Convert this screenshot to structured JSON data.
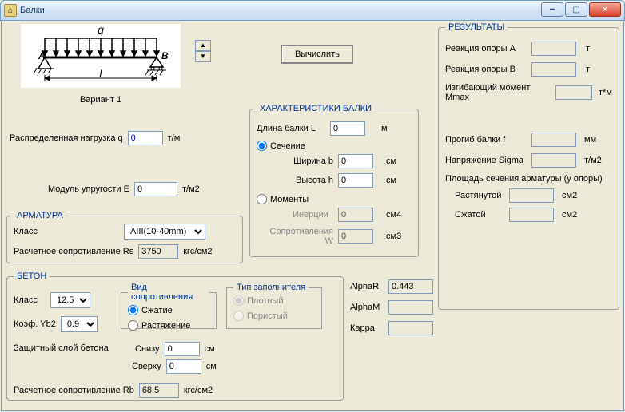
{
  "window": {
    "title": "Балки",
    "variant_label": "Вариант 1",
    "calc_button": "Вычислить"
  },
  "diagram": {
    "load_symbol": "q",
    "span_symbol": "l",
    "left_support": "A",
    "right_support": "B"
  },
  "inputs": {
    "distributed_load": {
      "label": "Распределенная нагрузка  q",
      "value": "0",
      "unit": "т/м"
    },
    "elastic_modulus": {
      "label": "Модуль упругости  E",
      "value": "0",
      "unit": "т/м2"
    }
  },
  "armatura": {
    "legend": "АРМАТУРА",
    "class_label": "Класс",
    "class_value": "AIII(10-40mm)",
    "rs_label": "Расчетное сопротивление Rs",
    "rs_value": "3750",
    "rs_unit": "кгс/см2"
  },
  "beton": {
    "legend": "БЕТОН",
    "class_label": "Класс",
    "class_value": "12.5",
    "yb2_label": "Коэф. Yb2",
    "yb2_value": "0.9",
    "resistance_group": {
      "legend": "Вид сопротивления",
      "compression": "Сжатие",
      "tension": "Растяжение"
    },
    "filler_group": {
      "legend": "Тип заполнителя",
      "dense": "Плотный",
      "porous": "Пористый"
    },
    "cover_label": "Защитный слой бетона",
    "cover_bottom_label": "Снизу",
    "cover_bottom_value": "0",
    "cover_top_label": "Сверху",
    "cover_top_value": "0",
    "cover_unit": "см",
    "rb_label": "Расчетное сопротивление Rb",
    "rb_value": "68.5",
    "rb_unit": "кгс/см2"
  },
  "characteristics": {
    "legend": "ХАРАКТЕРИСТИКИ БАЛКИ",
    "length_label": "Длина балки  L",
    "length_value": "0",
    "length_unit": "м",
    "section_radio": "Сечение",
    "width_label": "Ширина  b",
    "width_value": "0",
    "height_label": "Высота  h",
    "height_value": "0",
    "section_unit": "см",
    "moments_radio": "Моменты",
    "inertia_label": "Инерции   I",
    "inertia_value": "0",
    "inertia_unit": "см4",
    "resistance_label": "Сопротивления  W",
    "resistance_value": "0",
    "resistance_unit": "см3"
  },
  "greek": {
    "alpha_r_label": "AlphaR",
    "alpha_r_value": "0.443",
    "alpha_m_label": "AlphaM",
    "kappa_label": "Карра"
  },
  "results": {
    "legend": "РЕЗУЛЬТАТЫ",
    "reaction_a_label": "Реакция опоры A",
    "reaction_a_unit": "т",
    "reaction_b_label": "Реакция опоры B",
    "reaction_b_unit": "т",
    "mmax_label": "Изгибающий момент Mmax",
    "mmax_unit": "т*м",
    "deflection_label": "Прогиб балки   f",
    "deflection_unit": "мм",
    "sigma_label": "Напряжение Sigma",
    "sigma_unit": "т/м2",
    "rebar_area_label": "Площадь сечения арматуры (у опоры)",
    "tension_area_label": "Растянутой",
    "tension_area_unit": "см2",
    "compression_area_label": "Сжатой",
    "compression_area_unit": "см2"
  }
}
